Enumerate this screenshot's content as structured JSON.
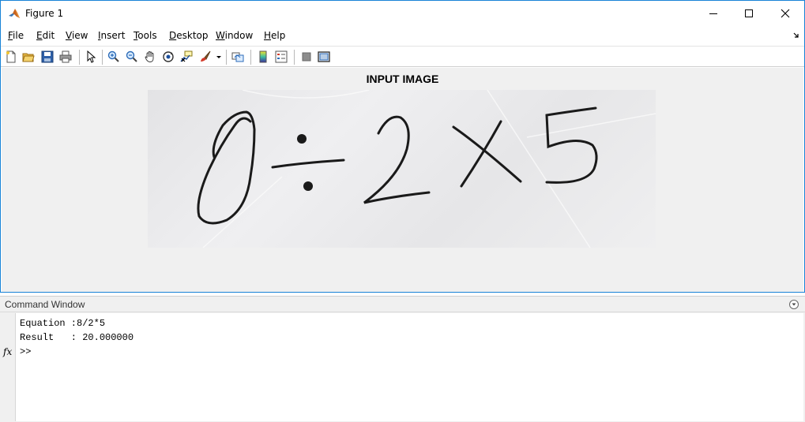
{
  "window": {
    "title": "Figure 1"
  },
  "menu": [
    {
      "label": "File",
      "accel": "F",
      "rest": "ile"
    },
    {
      "label": "Edit",
      "accel": "E",
      "rest": "dit"
    },
    {
      "label": "View",
      "accel": "V",
      "rest": "iew"
    },
    {
      "label": "Insert",
      "accel": "I",
      "rest": "nsert"
    },
    {
      "label": "Tools",
      "accel": "T",
      "rest": "ools"
    },
    {
      "label": "Desktop",
      "accel": "D",
      "rest": "esktop"
    },
    {
      "label": "Window",
      "accel": "W",
      "rest": "indow"
    },
    {
      "label": "Help",
      "accel": "H",
      "rest": "elp"
    }
  ],
  "toolbar_icons": [
    "new-figure-icon",
    "open-file-icon",
    "save-icon",
    "print-icon",
    "pointer-icon",
    "zoom-in-icon",
    "zoom-out-icon",
    "pan-icon",
    "rotate-3d-icon",
    "data-cursor-icon",
    "brush-icon",
    "link-plot-icon",
    "colorbar-icon",
    "legend-icon",
    "hide-plot-tools-icon",
    "show-plot-tools-icon"
  ],
  "axes": {
    "title": "INPUT IMAGE"
  },
  "image": {
    "handwritten_text": "8÷2X5"
  },
  "command_window": {
    "title": "Command Window",
    "lines": [
      "Equation :8/2*5",
      "Result   : 20.000000",
      ">>"
    ],
    "fx_label": "fx"
  },
  "colors": {
    "accent": "#1883d7",
    "canvas": "#f0f0f0"
  }
}
